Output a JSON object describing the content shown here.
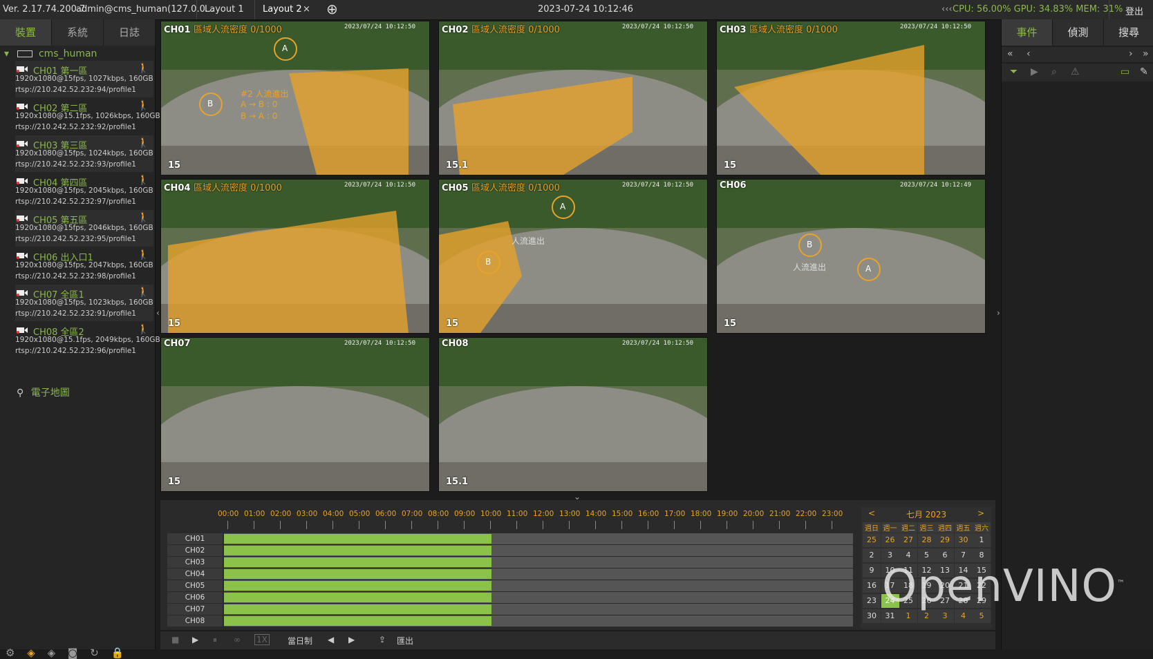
{
  "topbar": {
    "version": "Ver. 2.17.74.200.7",
    "user": "admin@cms_human(127.0.0...",
    "tabs": [
      "Layout 1",
      "Layout 2"
    ],
    "close_glyph": "×",
    "add_glyph": "⊕",
    "datetime": "2023-07-24 10:12:46",
    "stats": "CPU: 56.00% GPU: 34.83% MEM: 31%",
    "logout": "登出",
    "collapse_glyph": "‹‹‹"
  },
  "sidebar": {
    "tabs": [
      "裝置",
      "系統",
      "日誌"
    ],
    "root": "cms_human",
    "cameras": [
      {
        "name": "CH01 第一區",
        "spec": "1920x1080@15fps, 1027kbps, 160GB",
        "url": "rtsp://210.242.52.232:94/profile1"
      },
      {
        "name": "CH02 第二區",
        "spec": "1920x1080@15.1fps, 1026kbps, 160GB",
        "url": "rtsp://210.242.52.232:92/profile1"
      },
      {
        "name": "CH03 第三區",
        "spec": "1920x1080@15fps, 1024kbps, 160GB",
        "url": "rtsp://210.242.52.232:93/profile1"
      },
      {
        "name": "CH04 第四區",
        "spec": "1920x1080@15fps, 2045kbps, 160GB",
        "url": "rtsp://210.242.52.232:97/profile1"
      },
      {
        "name": "CH05 第五區",
        "spec": "1920x1080@15fps, 2046kbps, 160GB",
        "url": "rtsp://210.242.52.232:95/profile1"
      },
      {
        "name": "CH06 出入口1",
        "spec": "1920x1080@15fps, 2047kbps, 160GB",
        "url": "rtsp://210.242.52.232:98/profile1"
      },
      {
        "name": "CH07 全區1",
        "spec": "1920x1080@15fps, 1023kbps, 160GB",
        "url": "rtsp://210.242.52.232:91/profile1"
      },
      {
        "name": "CH08 全區2",
        "spec": "1920x1080@15.1fps, 2049kbps, 160GB",
        "url": "rtsp://210.242.52.232:96/profile1"
      }
    ],
    "emap": "電子地圖"
  },
  "tiles": [
    {
      "id": "CH01",
      "rule": "區域人流密度 0/1000",
      "ts": "2023/07/24 10:12:50",
      "fps": "15",
      "extra": [
        "#2 人流進出",
        "A → B : 0",
        "B → A : 0"
      ],
      "zone": "A",
      "zone2": "B"
    },
    {
      "id": "CH02",
      "rule": "區域人流密度 0/1000",
      "ts": "2023/07/24 10:12:50",
      "fps": "15.1"
    },
    {
      "id": "CH03",
      "rule": "區域人流密度 0/1000",
      "ts": "2023/07/24 10:12:50",
      "fps": "15"
    },
    {
      "id": "CH04",
      "rule": "區域人流密度 0/1000",
      "ts": "2023/07/24 10:12:50",
      "fps": "15"
    },
    {
      "id": "CH05",
      "rule": "區域人流密度 0/1000",
      "ts": "2023/07/24 10:12:50",
      "fps": "15",
      "zone": "A",
      "zone2": "B",
      "extra": [
        "人流進出"
      ]
    },
    {
      "id": "CH06",
      "rule": "",
      "ts": "2023/07/24 10:12:49",
      "fps": "15",
      "zone": "A",
      "zone2": "B",
      "extra": [
        "人流進出"
      ]
    },
    {
      "id": "CH07",
      "rule": "",
      "ts": "2023/07/24 10:12:50",
      "fps": "15"
    },
    {
      "id": "CH08",
      "rule": "",
      "ts": "2023/07/24 10:12:50",
      "fps": "15.1"
    }
  ],
  "timeline": {
    "hours": [
      "00:00",
      "01:00",
      "02:00",
      "03:00",
      "04:00",
      "05:00",
      "06:00",
      "07:00",
      "08:00",
      "09:00",
      "10:00",
      "11:00",
      "12:00",
      "13:00",
      "14:00",
      "15:00",
      "16:00",
      "17:00",
      "18:00",
      "19:00",
      "20:00",
      "21:00",
      "22:00",
      "23:00"
    ],
    "channels": [
      "CH01",
      "CH02",
      "CH03",
      "CH04",
      "CH05",
      "CH06",
      "CH07",
      "CH08"
    ],
    "recorded_until_hour": 10.2
  },
  "calendar": {
    "title": "七月 2023",
    "prev": "<",
    "next": ">",
    "dow": [
      "週日",
      "週一",
      "週二",
      "週三",
      "週四",
      "週五",
      "週六"
    ],
    "weeks": [
      [
        "25",
        "26",
        "27",
        "28",
        "29",
        "30",
        "1"
      ],
      [
        "2",
        "3",
        "4",
        "5",
        "6",
        "7",
        "8"
      ],
      [
        "9",
        "10",
        "11",
        "12",
        "13",
        "14",
        "15"
      ],
      [
        "16",
        "17",
        "18",
        "19",
        "20",
        "21",
        "22"
      ],
      [
        "23",
        "24",
        "25",
        "26",
        "27",
        "28",
        "29"
      ],
      [
        "30",
        "31",
        "1",
        "2",
        "3",
        "4",
        "5"
      ]
    ],
    "selected": "24"
  },
  "playbar": {
    "stop": "■",
    "play": "▶",
    "pause": "⏸",
    "loop": "∞",
    "speed": "1X",
    "mode": "當日制",
    "prev": "◀",
    "next": "▶",
    "export_icon": "⇪",
    "export": "匯出"
  },
  "rightpanel": {
    "tabs": [
      "事件",
      "偵測",
      "搜尋"
    ],
    "nav": [
      "«",
      "‹",
      "›",
      "»"
    ]
  },
  "logo": "OpenVINO",
  "logo_tm": "™",
  "colors": {
    "accent": "#8ab84a",
    "zone": "#e8a32a",
    "record": "#8bc34a"
  }
}
